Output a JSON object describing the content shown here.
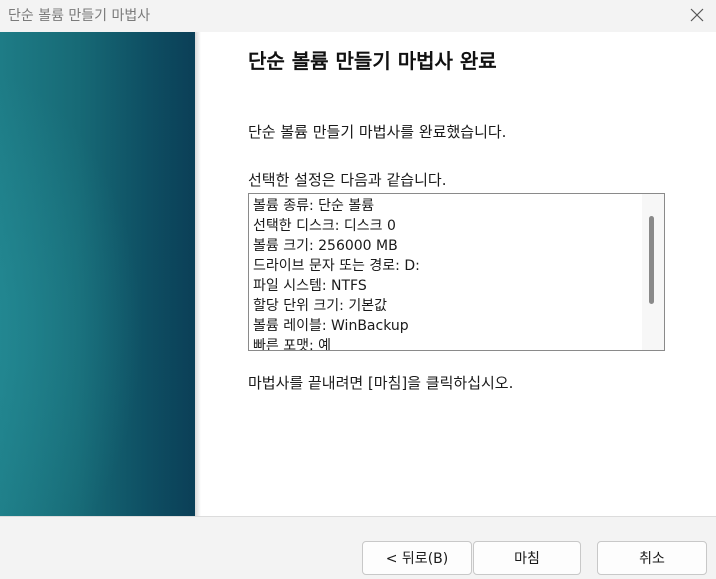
{
  "window": {
    "title": "단순 볼륨 만들기 마법사"
  },
  "page": {
    "heading": "단순 볼륨 만들기 마법사 완료",
    "completed_message": "단순 볼륨 만들기 마법사를 완료했습니다.",
    "settings_intro": "선택한 설정은 다음과 같습니다.",
    "settings": [
      "볼륨 종류: 단순 볼륨",
      "선택한 디스크: 디스크 0",
      "볼륨 크기: 256000 MB",
      "드라이브 문자 또는 경로: D:",
      "파일 시스템: NTFS",
      "할당 단위 크기: 기본값",
      "볼륨 레이블: WinBackup",
      "빠른 포맷: 예"
    ],
    "finish_instruction": "마법사를 끝내려면 [마침]을 클릭하십시오."
  },
  "buttons": {
    "back": "< 뒤로(B)",
    "finish": "마침",
    "cancel": "취소"
  },
  "icons": {
    "close": "close-icon"
  }
}
